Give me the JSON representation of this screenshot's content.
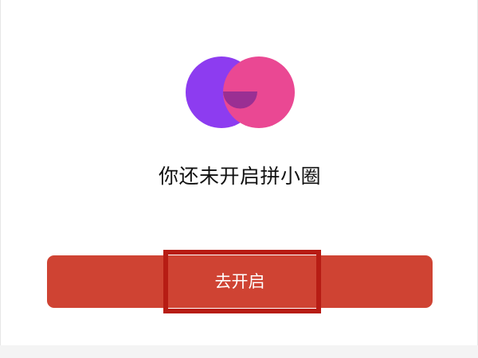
{
  "empty_state": {
    "logo_icon": "pinxiaoquan-overlapping-circles-icon",
    "title": "你还未开启拼小圈"
  },
  "action": {
    "open_label": "去开启"
  },
  "colors": {
    "circle_left": "#8d3cf0",
    "circle_right": "#ea4893",
    "circle_overlap": "#9a2f93",
    "button": "#cf4333",
    "highlight_border": "#b71c14",
    "page_background": "#f4f4f4",
    "card_background": "#ffffff"
  }
}
